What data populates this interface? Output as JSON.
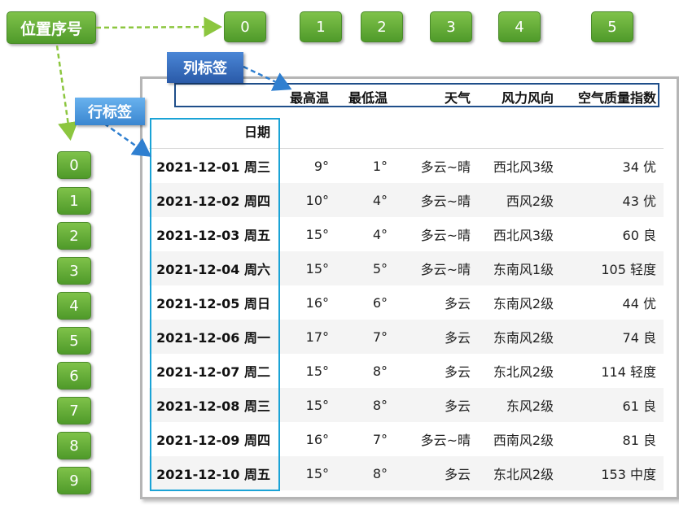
{
  "position_label": "位置序号",
  "column_callout": "列标签",
  "row_callout": "行标签",
  "column_positions": [
    "0",
    "1",
    "2",
    "3",
    "4",
    "5"
  ],
  "row_positions": [
    "0",
    "1",
    "2",
    "3",
    "4",
    "5",
    "6",
    "7",
    "8",
    "9"
  ],
  "table": {
    "index_name": "日期",
    "columns": [
      "最高温",
      "最低温",
      "天气",
      "风力风向",
      "空气质量指数"
    ],
    "rows": [
      {
        "index": "2021-12-01 周三",
        "cells": [
          "9°",
          "1°",
          "多云~晴",
          "西北风3级",
          "34 优"
        ]
      },
      {
        "index": "2021-12-02 周四",
        "cells": [
          "10°",
          "4°",
          "多云~晴",
          "西风2级",
          "43 优"
        ]
      },
      {
        "index": "2021-12-03 周五",
        "cells": [
          "15°",
          "4°",
          "多云~晴",
          "西北风3级",
          "60 良"
        ]
      },
      {
        "index": "2021-12-04 周六",
        "cells": [
          "15°",
          "5°",
          "多云~晴",
          "东南风1级",
          "105 轻度"
        ]
      },
      {
        "index": "2021-12-05 周日",
        "cells": [
          "16°",
          "6°",
          "多云",
          "东南风2级",
          "44 优"
        ]
      },
      {
        "index": "2021-12-06 周一",
        "cells": [
          "17°",
          "7°",
          "多云",
          "东南风2级",
          "74 良"
        ]
      },
      {
        "index": "2021-12-07 周二",
        "cells": [
          "15°",
          "8°",
          "多云",
          "东北风2级",
          "114 轻度"
        ]
      },
      {
        "index": "2021-12-08 周三",
        "cells": [
          "15°",
          "8°",
          "多云",
          "东风2级",
          "61 良"
        ]
      },
      {
        "index": "2021-12-09 周四",
        "cells": [
          "16°",
          "7°",
          "多云~晴",
          "西南风2级",
          "81 良"
        ]
      },
      {
        "index": "2021-12-10 周五",
        "cells": [
          "15°",
          "8°",
          "多云",
          "东北风2级",
          "153 中度"
        ]
      }
    ]
  },
  "colors": {
    "green_box": "#5faa32",
    "column_box_border": "#1f4e8a",
    "row_box_border": "#1aa3d6",
    "arrow_green": "#8cc63f",
    "arrow_blue": "#2f7fd0"
  }
}
